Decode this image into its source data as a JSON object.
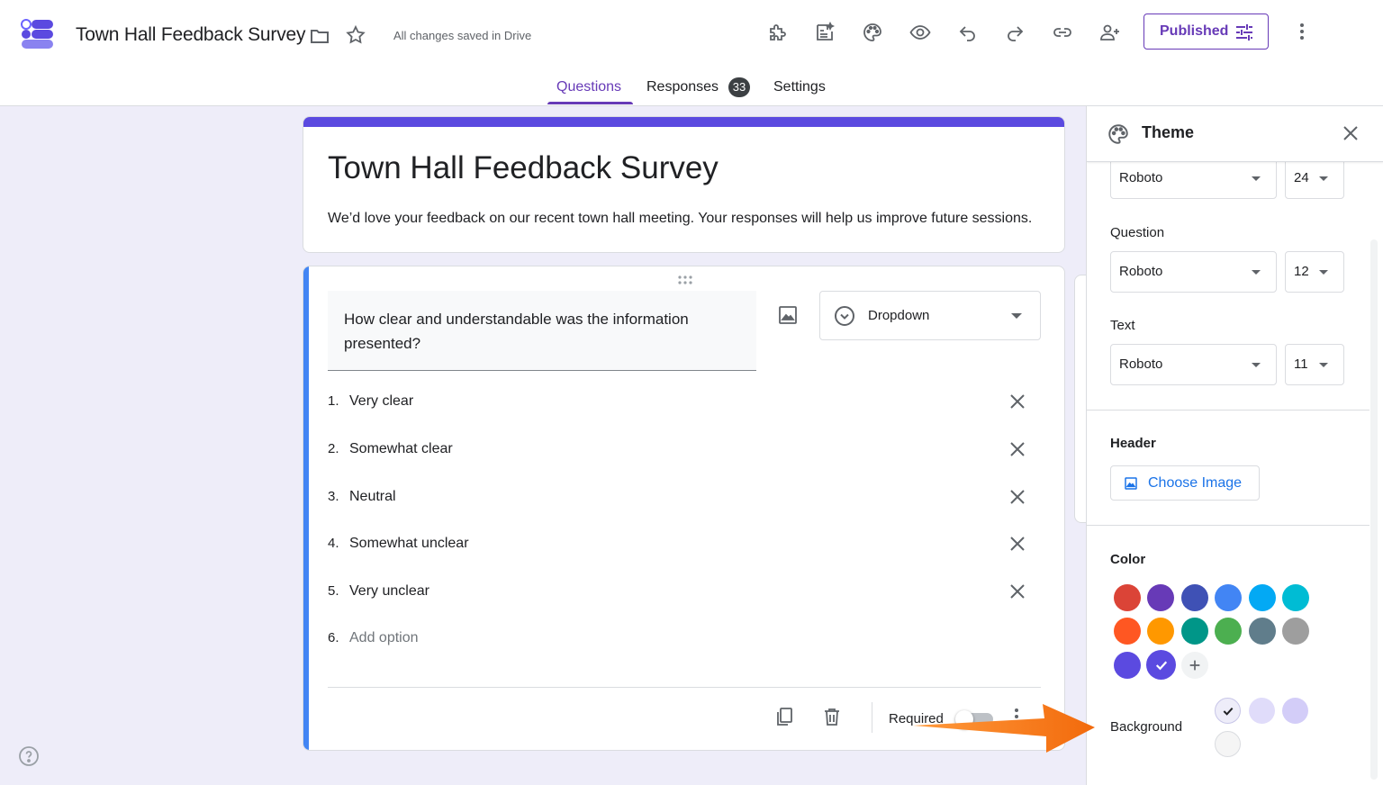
{
  "header": {
    "doc_title": "Town Hall Feedback Survey",
    "save_status": "All changes saved in Drive",
    "publish_label": "Published",
    "toolbar_icons": [
      "addons-icon",
      "ai-assist-icon",
      "palette-icon",
      "preview-icon",
      "undo-icon",
      "redo-icon",
      "link-icon",
      "add-collaborator-icon"
    ]
  },
  "tabs": {
    "questions": "Questions",
    "responses": "Responses",
    "responses_count": "33",
    "settings": "Settings"
  },
  "form": {
    "title": "Town Hall Feedback Survey",
    "description": "We’d love your feedback on our recent town hall meeting. Your responses will help us improve future sessions.",
    "accent_color": "#5b4ae0"
  },
  "question": {
    "text": "How clear and understandable was the information presented?",
    "type": "Dropdown",
    "options": [
      {
        "num": "1.",
        "label": "Very clear"
      },
      {
        "num": "2.",
        "label": "Somewhat clear"
      },
      {
        "num": "3.",
        "label": "Neutral"
      },
      {
        "num": "4.",
        "label": "Somewhat unclear"
      },
      {
        "num": "5.",
        "label": "Very unclear"
      }
    ],
    "add_option": {
      "num": "6.",
      "label": "Add option"
    },
    "required_label": "Required",
    "required": false
  },
  "theme": {
    "title": "Theme",
    "header_font": {
      "family": "Roboto",
      "size": "24"
    },
    "question_label": "Question",
    "question_font": {
      "family": "Roboto",
      "size": "12"
    },
    "text_label": "Text",
    "text_font": {
      "family": "Roboto",
      "size": "11"
    },
    "header_label": "Header",
    "choose_image": "Choose Image",
    "color_label": "Color",
    "colors": [
      "#db4437",
      "#673ab7",
      "#3f51b5",
      "#4285f4",
      "#03a9f4",
      "#00bcd4",
      "#ff5722",
      "#ff9800",
      "#009688",
      "#4caf50",
      "#607d8b",
      "#9e9e9e",
      "#5b4ae0",
      "#5b4ae0"
    ],
    "selected_color": "#5b4ae0",
    "background_label": "Background",
    "background_colors": [
      "#eeedf9",
      "#e0dcfa",
      "#d3cdf8",
      "#f5f5f5"
    ]
  }
}
